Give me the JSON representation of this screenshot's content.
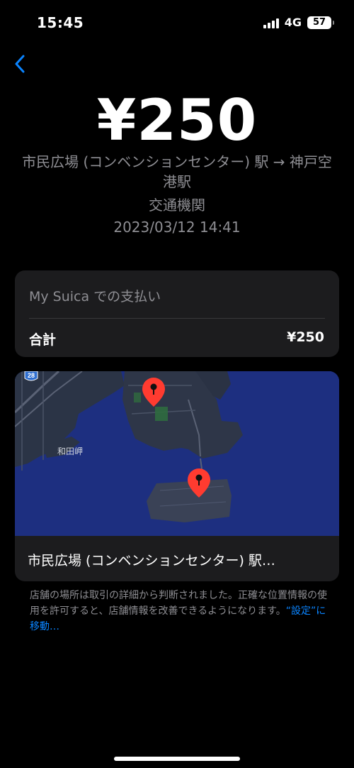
{
  "status_bar": {
    "time": "15:45",
    "network": "4G",
    "battery": "57"
  },
  "transaction": {
    "amount": "¥250",
    "route": "市民広場 (コンベンションセンター) 駅 → 神戸空港駅",
    "category": "交通機関",
    "datetime": "2023/03/12 14:41"
  },
  "payment": {
    "method": "My Suica での支払い",
    "total_label": "合計",
    "total_value": "¥250"
  },
  "map": {
    "place_label": "和田岬",
    "route_shield": "28",
    "station_name": "市民広場 (コンベンションセンター) 駅…",
    "pin_color": "#ff3b30",
    "water_color": "#1d2f80"
  },
  "footnote": {
    "text": "店舗の場所は取引の詳細から判断されました。正確な位置情報の使用を許可すると、店舗情報を改善できるようになります。",
    "link": "“設定”に移動…"
  },
  "colors": {
    "accent": "#0a84ff",
    "secondary_text": "#8e8e93",
    "card_bg": "#1c1c1e"
  }
}
